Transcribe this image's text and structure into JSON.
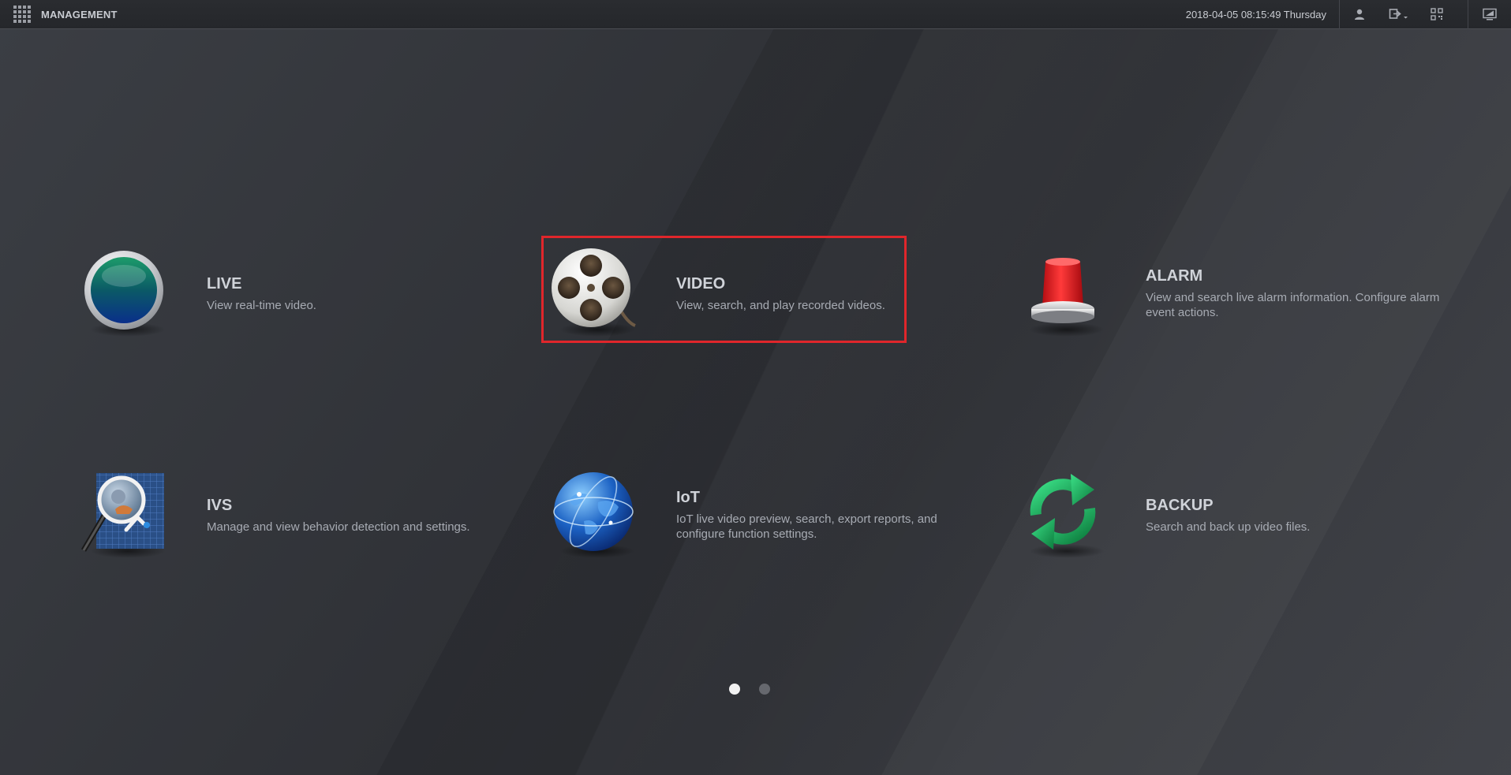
{
  "header": {
    "title": "MANAGEMENT",
    "datetime": "2018-04-05 08:15:49 Thursday"
  },
  "icons": {
    "menu": "grid-menu-icon",
    "user": "user-icon",
    "logout": "logout-icon",
    "qr": "qr-code-icon",
    "display": "monitor-icon"
  },
  "tiles": [
    {
      "id": "live",
      "title": "LIVE",
      "desc": "View real-time video.",
      "icon": "live-lens-icon"
    },
    {
      "id": "video",
      "title": "VIDEO",
      "desc": "View, search, and play recorded videos.",
      "icon": "film-reel-icon"
    },
    {
      "id": "alarm",
      "title": "ALARM",
      "desc": "View and search live alarm information. Configure alarm event actions.",
      "icon": "alarm-siren-icon"
    },
    {
      "id": "ivs",
      "title": "IVS",
      "desc": "Manage and view behavior detection and settings.",
      "icon": "ivs-magnifier-icon"
    },
    {
      "id": "iot",
      "title": "IoT",
      "desc": "IoT live video preview, search, export reports, and configure function settings.",
      "icon": "globe-icon"
    },
    {
      "id": "backup",
      "title": "BACKUP",
      "desc": "Search and back up video files.",
      "icon": "refresh-arrows-icon"
    }
  ],
  "highlight_color": "#e0262b",
  "pager": {
    "current_page": 1,
    "total_pages": 2
  }
}
